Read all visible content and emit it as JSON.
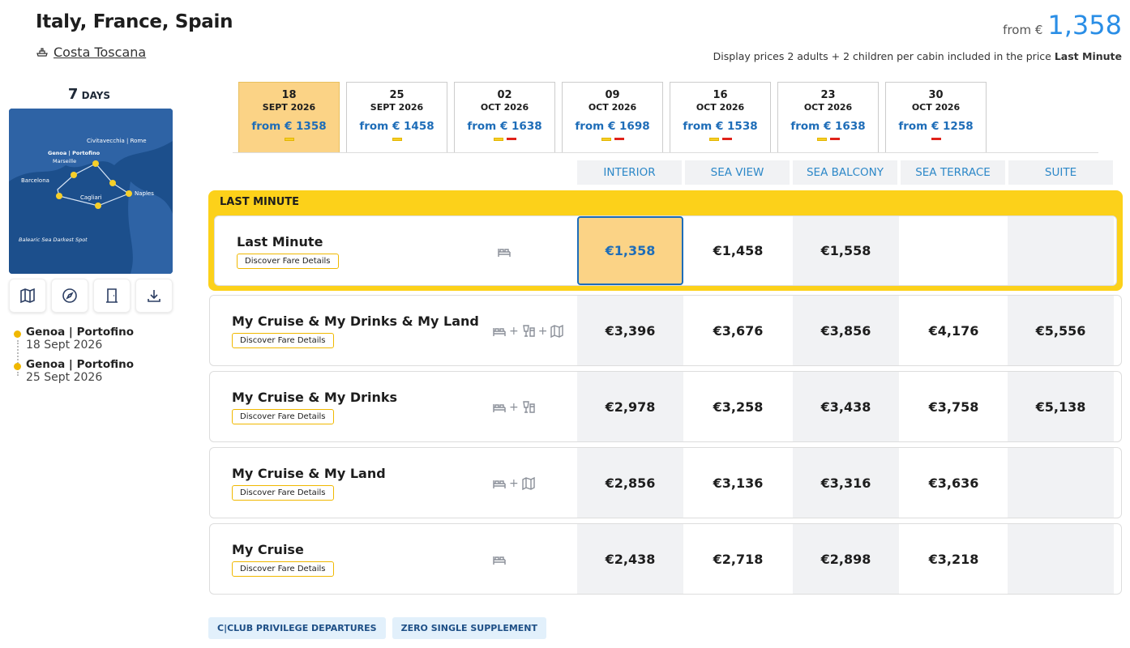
{
  "header": {
    "title": "Italy, France, Spain",
    "ship": "Costa Toscana",
    "price_prefix": "from €",
    "price": "1,358",
    "display_note": "Display prices 2 adults + 2 children per cabin included in the price",
    "display_note_bold": "Last Minute"
  },
  "itinerary": {
    "days_number": "7",
    "days_label": "DAYS",
    "map_labels": {
      "civitavecchia": "Civitavecchia | Rome",
      "genoa": "Genoa | Portofino",
      "marseille": "Marseille",
      "barcelona": "Barcelona",
      "cagliari": "Cagliari",
      "naples": "Naples",
      "balearic": "Balearic Sea Darkest Spot"
    },
    "ports": [
      {
        "name": "Genoa | Portofino",
        "date": "18 Sept 2026"
      },
      {
        "name": "Genoa | Portofino",
        "date": "25 Sept 2026"
      }
    ]
  },
  "dates": [
    {
      "day": "18",
      "month": "SEPT 2026",
      "price": "from € 1358",
      "active": true,
      "marks": [
        "y"
      ]
    },
    {
      "day": "25",
      "month": "SEPT 2026",
      "price": "from € 1458",
      "active": false,
      "marks": [
        "y"
      ]
    },
    {
      "day": "02",
      "month": "OCT 2026",
      "price": "from € 1638",
      "active": false,
      "marks": [
        "y",
        "r"
      ]
    },
    {
      "day": "09",
      "month": "OCT 2026",
      "price": "from € 1698",
      "active": false,
      "marks": [
        "y",
        "r"
      ]
    },
    {
      "day": "16",
      "month": "OCT 2026",
      "price": "from € 1538",
      "active": false,
      "marks": [
        "y",
        "r"
      ]
    },
    {
      "day": "23",
      "month": "OCT 2026",
      "price": "from € 1638",
      "active": false,
      "marks": [
        "y",
        "r"
      ]
    },
    {
      "day": "30",
      "month": "OCT 2026",
      "price": "from € 1258",
      "active": false,
      "marks": [
        "r"
      ]
    }
  ],
  "columns": [
    "INTERIOR",
    "SEA VIEW",
    "SEA BALCONY",
    "SEA TERRACE",
    "SUITE"
  ],
  "last_minute_label": "LAST MINUTE",
  "fare_button": "Discover Fare Details",
  "fares": [
    {
      "name": "Last Minute",
      "icons": [
        "bed"
      ],
      "prices": [
        "€1,358",
        "€1,458",
        "€1,558",
        "",
        ""
      ]
    },
    {
      "name": "My Cruise & My Drinks & My Land",
      "icons": [
        "bed",
        "+",
        "drinks",
        "+",
        "map"
      ],
      "prices": [
        "€3,396",
        "€3,676",
        "€3,856",
        "€4,176",
        "€5,556"
      ]
    },
    {
      "name": "My Cruise & My Drinks",
      "icons": [
        "bed",
        "+",
        "drinks"
      ],
      "prices": [
        "€2,978",
        "€3,258",
        "€3,438",
        "€3,758",
        "€5,138"
      ]
    },
    {
      "name": "My Cruise & My Land",
      "icons": [
        "bed",
        "+",
        "map"
      ],
      "prices": [
        "€2,856",
        "€3,136",
        "€3,316",
        "€3,636",
        ""
      ]
    },
    {
      "name": "My Cruise",
      "icons": [
        "bed"
      ],
      "prices": [
        "€2,438",
        "€2,718",
        "€2,898",
        "€3,218",
        ""
      ]
    }
  ],
  "badges": [
    "C|CLUB PRIVILEGE DEPARTURES",
    "ZERO SINGLE SUPPLEMENT"
  ],
  "colors": {
    "accent": "#2a8ee6",
    "highlight": "#fcd11a",
    "selected": "#fbd386"
  }
}
